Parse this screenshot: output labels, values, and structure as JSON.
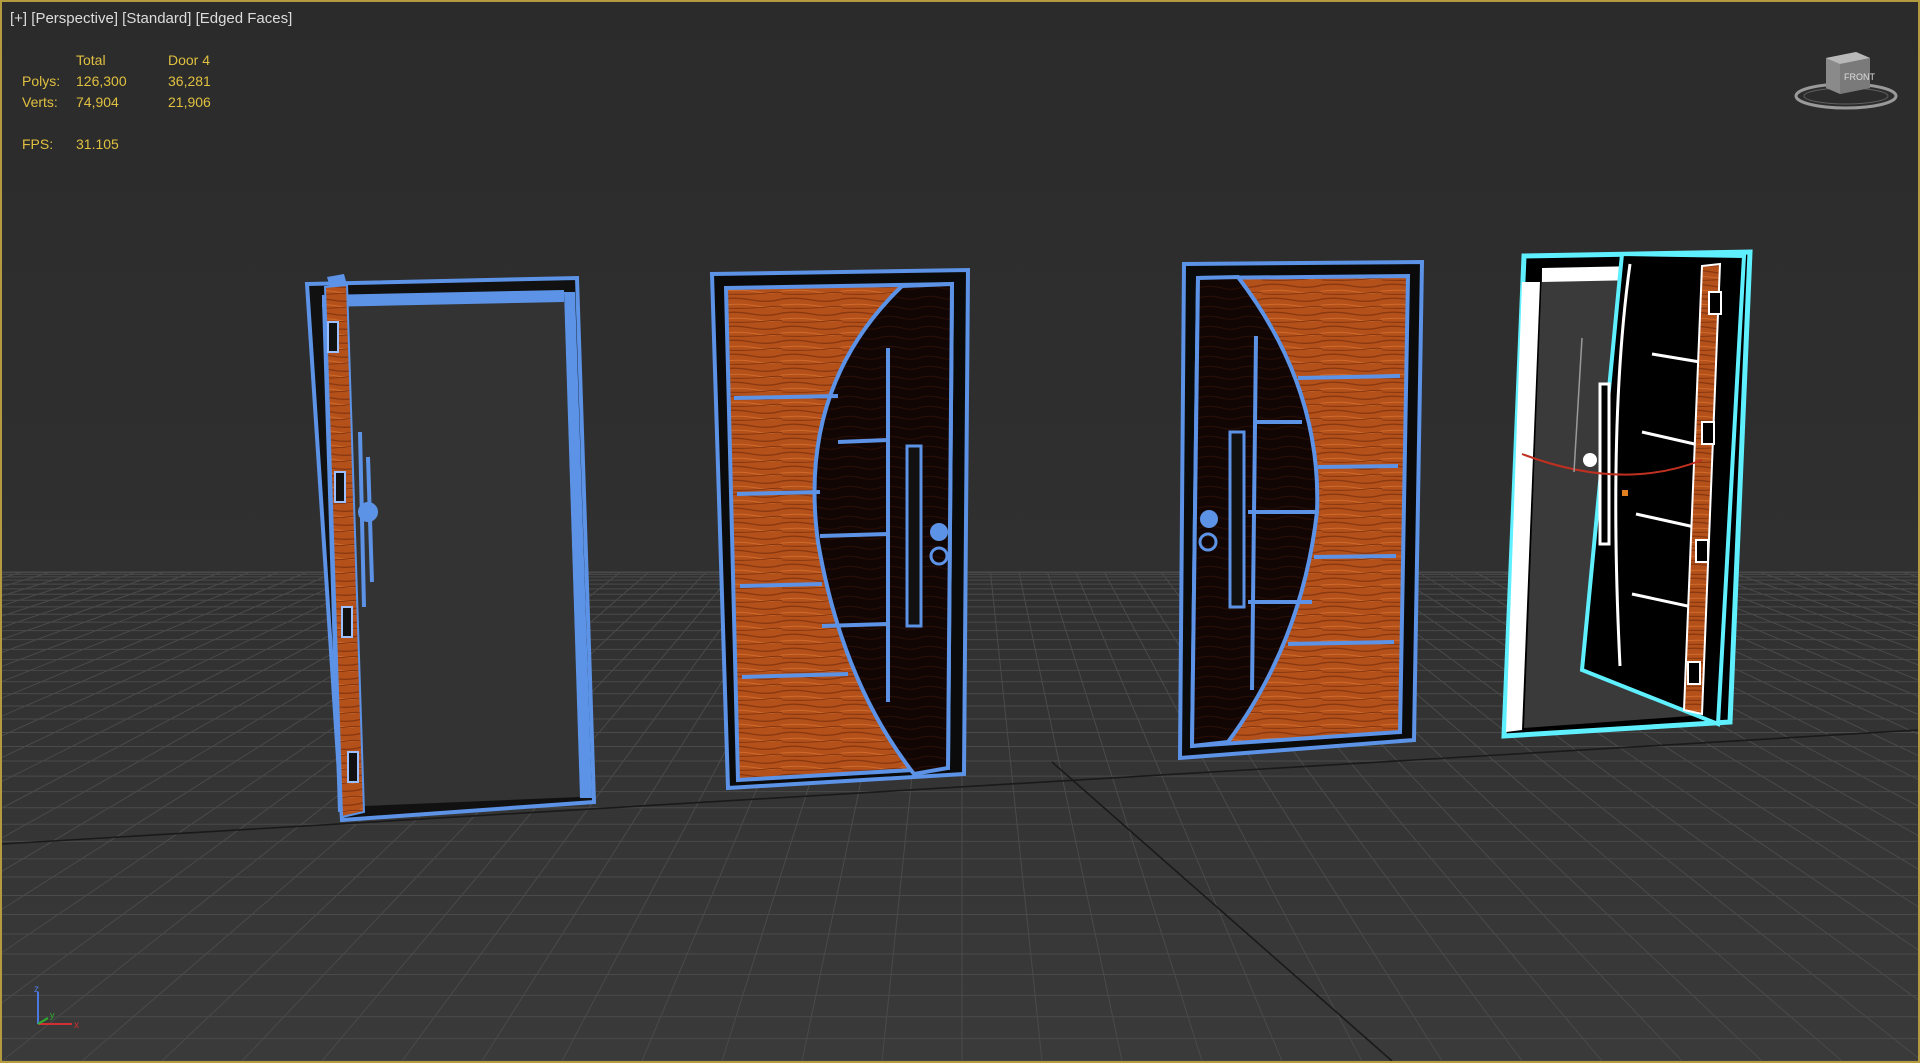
{
  "viewport": {
    "labels": [
      "[+]",
      "[Perspective]",
      "[Standard]",
      "[Edged Faces]"
    ]
  },
  "stats": {
    "header": {
      "label": "",
      "total": "Total",
      "selected": "Door 4"
    },
    "rows": [
      {
        "label": "Polys:",
        "total": "126,300",
        "selected": "36,281"
      },
      {
        "label": "Verts:",
        "total": "74,904",
        "selected": "21,906"
      }
    ],
    "fps": {
      "label": "FPS:",
      "value": "31.105"
    }
  },
  "viewcube": {
    "face_label": "FRONT",
    "icon": "viewcube-icon"
  },
  "axis_tripod": {
    "x": "x",
    "y": "y",
    "z": "z"
  },
  "colors": {
    "frame_border": "#b59b3f",
    "wire_blue": "#5c93e6",
    "wire_selected": "#5ff0ff",
    "wood": "#b4501a",
    "stats_text": "#e0c040"
  },
  "scene": {
    "objects": [
      "door-1",
      "door-2",
      "door-3",
      "door-4"
    ],
    "selected": "door-4"
  }
}
